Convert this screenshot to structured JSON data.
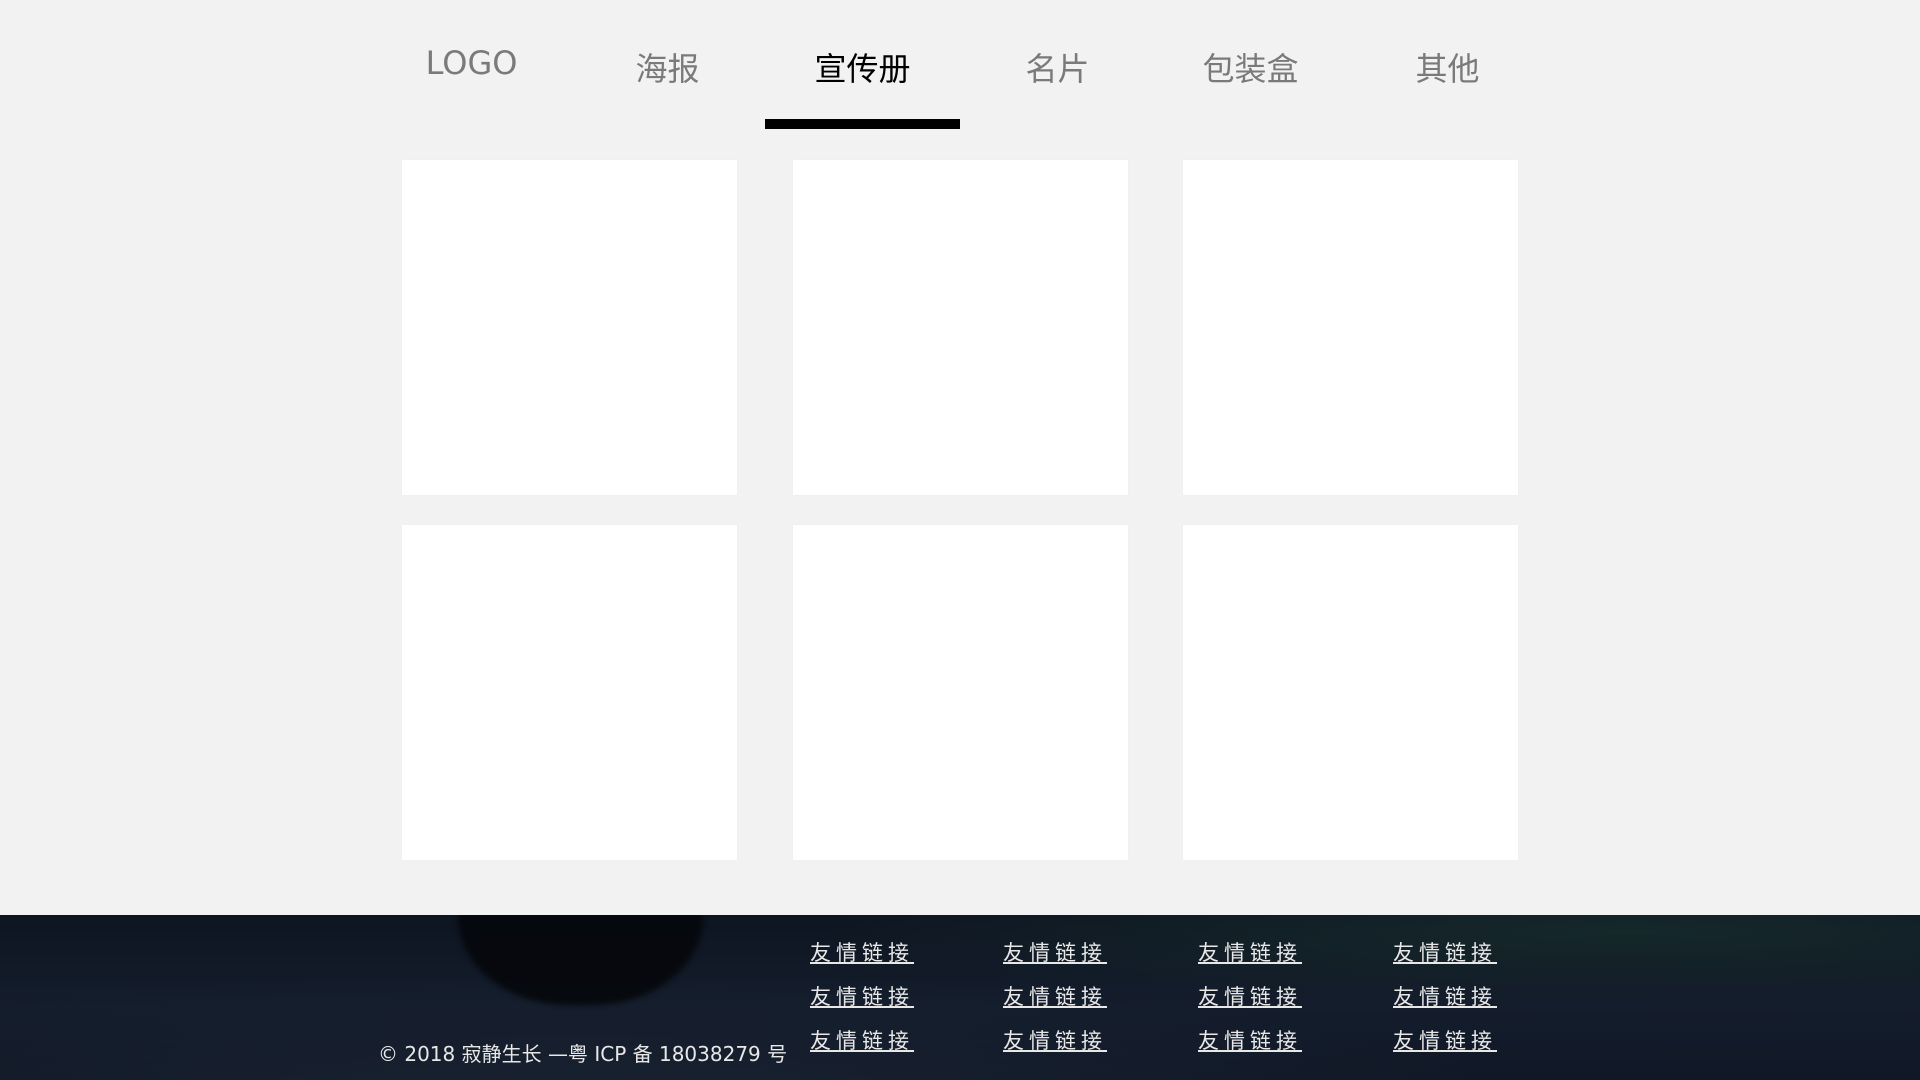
{
  "tabs": [
    {
      "label": "LOGO",
      "active": false
    },
    {
      "label": "海报",
      "active": false
    },
    {
      "label": "宣传册",
      "active": true
    },
    {
      "label": "名片",
      "active": false
    },
    {
      "label": "包装盒",
      "active": false
    },
    {
      "label": "其他",
      "active": false
    }
  ],
  "gallery": {
    "item_count": 6
  },
  "footer": {
    "copyright": "© 2018 寂静生长 —粤 ICP 备 18038279 号",
    "links": [
      [
        "友情链接",
        "友情链接",
        "友情链接",
        "友情链接"
      ],
      [
        "友情链接",
        "友情链接",
        "友情链接",
        "友情链接"
      ],
      [
        "友情链接",
        "友情链接",
        "友情链接",
        "友情链接"
      ]
    ]
  },
  "colors": {
    "background": "#f2f2f2",
    "active_tab": "#000000",
    "inactive_tab": "#7a7a7a",
    "card": "#ffffff",
    "footer_bg": "#111a27",
    "footer_text": "#e8e8e8"
  }
}
